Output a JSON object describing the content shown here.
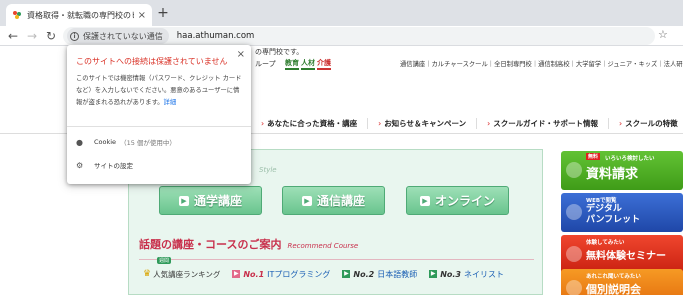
{
  "browser": {
    "tab_title": "資格取得・就転職の専門校のヒュー",
    "tab_close": "×",
    "new_tab": "+",
    "security_label": "保護されていない通信",
    "url": "haa.athuman.com",
    "accent": "#d93025"
  },
  "popup": {
    "title": "このサイトへの接続は保護されていません",
    "body": "このサイトでは機密情報（パスワード、クレジット カードなど）を入力しないでください。悪意のあるユーザーに情報が盗まれる恐れがあります。",
    "details_link": "詳細",
    "close": "×",
    "cookie_label": "Cookie",
    "cookie_count": "（15 個が使用中）",
    "site_settings_label": "サイトの設定"
  },
  "site": {
    "tagline": "の専門校です。",
    "group_label": "ループ",
    "quick_links": [
      "教育",
      "人材",
      "介護"
    ],
    "top_links": "通信講座｜カルチャースクール｜全日制専門校｜通信制高校｜大学留学｜ジュニア・キッズ｜法人研",
    "nav": [
      "あなたに合った資格・講座",
      "お知らせ＆キャンペーン",
      "スクールガイド・サポート情報",
      "スクールの特徴"
    ],
    "style_word": "Style",
    "buttons": [
      "通学講座",
      "通信講座",
      "オンライン"
    ],
    "recommend_ja": "話題の講座・コースのご案内",
    "recommend_en": "Recommend Course",
    "ranking_badge": "週間",
    "ranking_label": "人気講座ランキング",
    "ranking": [
      {
        "no": "No.1",
        "name": "ITプログラミング"
      },
      {
        "no": "No.2",
        "name": "日本語教師"
      },
      {
        "no": "No.3",
        "name": "ネイリスト"
      }
    ],
    "side": [
      {
        "small": "いろいろ検討したい",
        "badge": "無料",
        "large": "資料請求"
      },
      {
        "small": "WEBで閲覧",
        "large": "デジタル\nパンフレット"
      },
      {
        "small": "体験してみたい",
        "large": "無料体験セミナー"
      },
      {
        "small": "あれこれ聞いてみたい",
        "large": "個別説明会"
      }
    ]
  }
}
